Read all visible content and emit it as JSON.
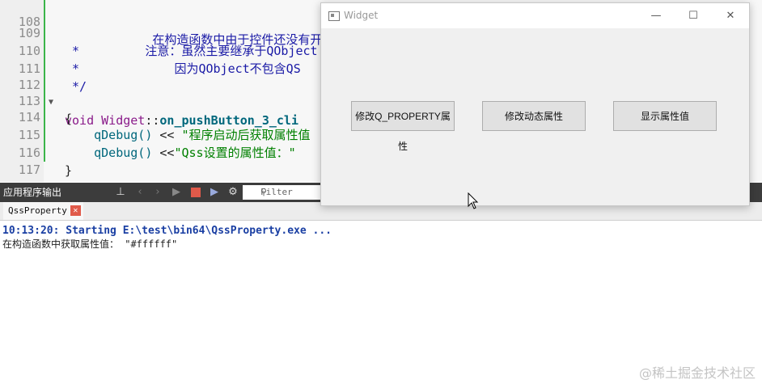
{
  "editor": {
    "lines": [
      {
        "num": "108",
        "text": "            在构造函数中由于控件还没有开始显示，所以Q_PROPERTY没生效，这儿会获取修改后的属性值的，在面会显示"
      },
      {
        "num": "109",
        "text": " *         注意：虽然主要继承于QObject"
      },
      {
        "num": "110",
        "text": " *             因为QObject不包含QS"
      },
      {
        "num": "111",
        "text": " */"
      },
      {
        "num": "112",
        "kw": "void ",
        "cls": "Widget",
        "sep": "::",
        "fn": "on_pushButton_3_cli"
      },
      {
        "num": "113",
        "text": "{"
      },
      {
        "num": "114",
        "dbg": "    qDebug() ",
        "op": "<< ",
        "str": "\"程序启动后获取属性值"
      },
      {
        "num": "115",
        "dbg": "    qDebug() ",
        "op": "<<",
        "str": "\"Qss设置的属性值：\""
      },
      {
        "num": "116",
        "text": "}"
      },
      {
        "num": "117",
        "text": ""
      }
    ]
  },
  "output_pane": {
    "title": "应用程序输出",
    "filter_placeholder": "Filter",
    "tab_label": "QssProperty",
    "lines": [
      "10:13:20: Starting E:\\test\\bin64\\QssProperty.exe ...",
      "在构造函数中获取属性值： \"#ffffff\""
    ]
  },
  "widget": {
    "title": "Widget",
    "minimize": "—",
    "maximize": "☐",
    "close": "✕",
    "buttons": [
      {
        "label": "修改Q_PROPERTY属性"
      },
      {
        "label": "修改动态属性"
      },
      {
        "label": "显示属性值"
      }
    ]
  },
  "watermark": "@稀土掘金技术社区"
}
